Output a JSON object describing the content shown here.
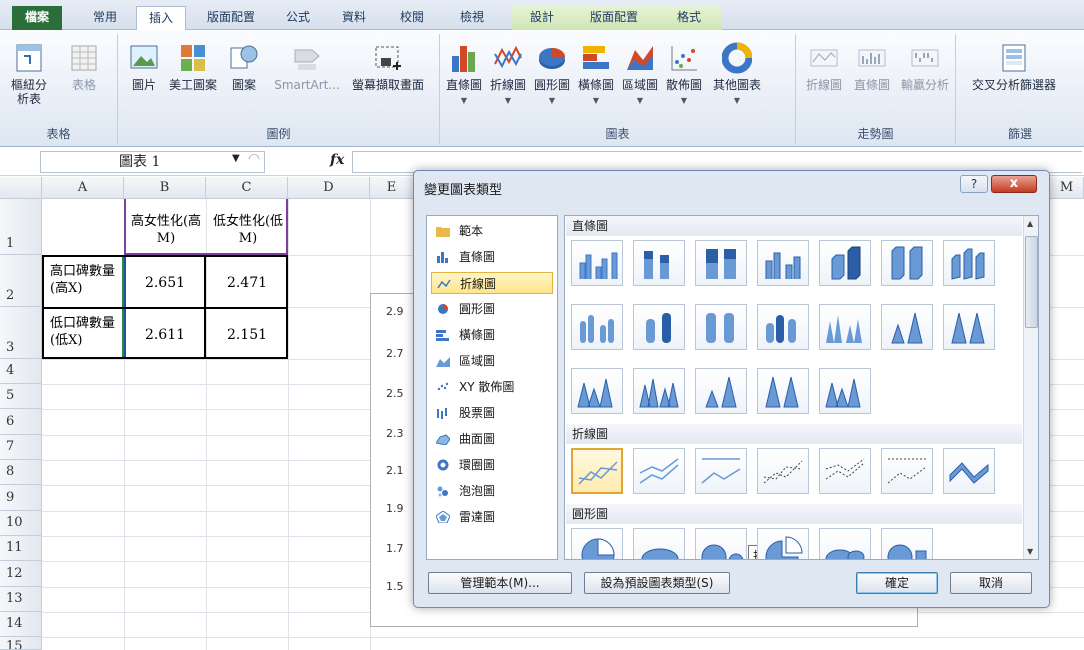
{
  "tabs": [
    "檔案",
    "常用",
    "插入",
    "版面配置",
    "公式",
    "資料",
    "校閱",
    "檢視",
    "設計",
    "版面配置",
    "格式"
  ],
  "ribbon": {
    "groups": {
      "tables": "表格",
      "illustrations": "圖例",
      "charts": "圖表",
      "sparklines": "走勢圖",
      "filter": "篩選"
    },
    "buttons": {
      "pivot": "樞紐分析表",
      "table": "表格",
      "picture": "圖片",
      "clipart": "美工圖案",
      "shapes": "圖案",
      "smartart": "SmartArt...",
      "screenshot": "螢幕擷取畫面",
      "column": "直條圖",
      "line": "折線圖",
      "pie": "圓形圖",
      "bar": "橫條圖",
      "area": "區域圖",
      "scatter": "散佈圖",
      "other": "其他圖表",
      "sp_line": "折線圖",
      "sp_column": "直條圖",
      "sp_winloss": "輸贏分析",
      "slicer": "交叉分析篩選器"
    }
  },
  "namebox": "圖表 1",
  "fx": "fx",
  "columns": [
    "A",
    "B",
    "C",
    "D",
    "E",
    "M"
  ],
  "rows": [
    "1",
    "2",
    "3",
    "4",
    "5",
    "6",
    "7",
    "8",
    "9",
    "10",
    "11",
    "12",
    "13",
    "14",
    "15"
  ],
  "cells": {
    "b1": "高女性化(高M)",
    "c1": "低女性化(低M)",
    "a2": "高口碑數量(高X)",
    "b2": "2.651",
    "c2": "2.471",
    "a3": "低口碑數量(低X)",
    "b3": "2.611",
    "c3": "2.151"
  },
  "chart_axis": [
    "2.9",
    "2.7",
    "2.5",
    "2.3",
    "2.1",
    "1.9",
    "1.7",
    "1.5"
  ],
  "dialog": {
    "title": "變更圖表類型",
    "help": "?",
    "close": "x",
    "categories": [
      "範本",
      "直條圖",
      "折線圖",
      "圓形圖",
      "橫條圖",
      "區域圖",
      "XY 散佈圖",
      "股票圖",
      "曲面圖",
      "環圈圖",
      "泡泡圖",
      "雷達圖"
    ],
    "sections": [
      "直條圖",
      "折線圖",
      "圓形圖"
    ],
    "tooltip": "折線圖",
    "buttons": {
      "manage": "管理範本(M)...",
      "default": "設為預設圖表類型(S)",
      "ok": "確定",
      "cancel": "取消"
    }
  },
  "colors": {
    "file_tab": "#2a6e3a",
    "chart_tools": "#cfe6b6",
    "selection": "#ffe48a",
    "accent_blue": "#3c76c4"
  }
}
